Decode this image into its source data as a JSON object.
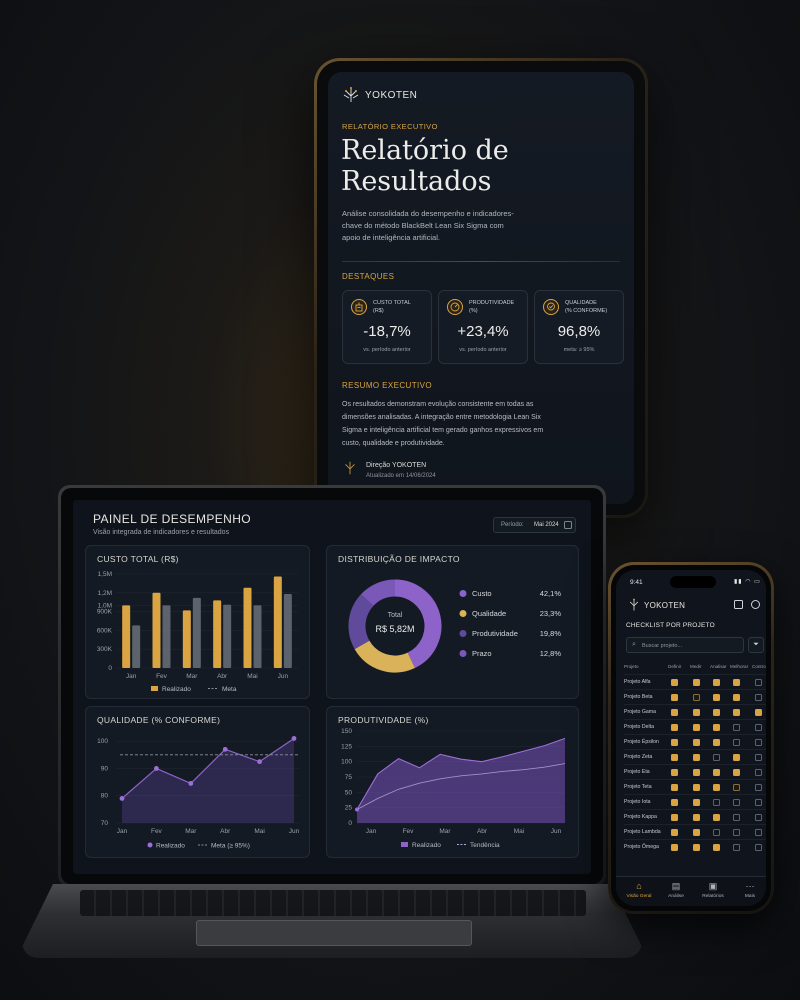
{
  "colors": {
    "gold": "#d9a441",
    "purple": "#8e63c9",
    "purple_light": "#b48be5",
    "bg": "#10151d",
    "slate": "#6f7680"
  },
  "tablet": {
    "brand": "YOKOTEN",
    "eyebrow": "RELATÓRIO EXECUTIVO",
    "title_line1": "Relatório de",
    "title_line2": "Resultados",
    "description_lines": [
      "Análise consolidada do desempenho e indicadores-",
      "chave do método BlackBelt Lean Six Sigma com",
      "apoio de inteligência artificial."
    ],
    "highlights_title": "DESTAQUES",
    "kpis": [
      {
        "icon": "cost-building-icon",
        "label_line1": "CUSTO TOTAL",
        "label_line2": "(R$)",
        "value": "-18,7%",
        "note": "vs. período anterior"
      },
      {
        "icon": "productivity-gauge-icon",
        "label_line1": "PRODUTIVIDADE",
        "label_line2": "(%)",
        "value": "+23,4%",
        "note": "vs. período anterior"
      },
      {
        "icon": "quality-badge-icon",
        "label_line1": "QUALIDADE",
        "label_line2": "(% CONFORME)",
        "value": "96,8%",
        "note": "meta: ≥ 95%"
      }
    ],
    "summary_title": "RESUMO EXECUTIVO",
    "summary_lines": [
      "Os resultados demonstram evolução consistente em todas as",
      "dimensões analisadas. A integração entre metodologia Lean Six",
      "Sigma e inteligência artificial tem gerado ganhos expressivos em",
      "custo, qualidade e produtividade."
    ],
    "signature_name": "Direção YOKOTEN",
    "signature_date": "Atualizado em 14/06/2024"
  },
  "laptop": {
    "title": "PAINEL DE DESEMPENHO",
    "subtitle": "Visão integrada de indicadores e resultados",
    "period_label": "Período:",
    "period_value": "Mai 2024",
    "cost_panel_title": "CUSTO TOTAL (R$)",
    "impact_panel_title": "DISTRIBUIÇÃO DE IMPACTO",
    "quality_panel_title": "QUALIDADE (% CONFORME)",
    "productivity_panel_title": "PRODUTIVIDADE (%)",
    "donut_center_label": "Total",
    "donut_center_value": "R$ 5,82M"
  },
  "chart_data": [
    {
      "type": "bar",
      "title": "CUSTO TOTAL (R$)",
      "categories": [
        "Jan",
        "Fev",
        "Mar",
        "Abr",
        "Mai",
        "Jun"
      ],
      "y_ticks": [
        "0",
        "300K",
        "600K",
        "900K",
        "1,0M",
        "1,2M",
        "1,5M"
      ],
      "ylim": [
        0,
        1500000
      ],
      "series": [
        {
          "name": "Realizado",
          "color": "#d9a441",
          "values": [
            1000000,
            1200000,
            920000,
            1080000,
            1280000,
            1460000
          ]
        },
        {
          "name": "Meta",
          "color": "#6f7680",
          "values": [
            680000,
            1000000,
            1120000,
            1010000,
            1000000,
            1180000
          ]
        }
      ]
    },
    {
      "type": "pie",
      "title": "DISTRIBUIÇÃO DE IMPACTO",
      "slices": [
        {
          "label": "Custo",
          "value": 42.1,
          "display": "42,1%",
          "color": "#8e63c9"
        },
        {
          "label": "Qualidade",
          "value": 23.3,
          "display": "23,3%",
          "color": "#d9b25a"
        },
        {
          "label": "Produtividade",
          "value": 19.8,
          "display": "19,8%",
          "color": "#5f4a9c"
        },
        {
          "label": "Prazo",
          "value": 12.8,
          "display": "12,8%",
          "color": "#7a58b8"
        }
      ]
    },
    {
      "type": "line",
      "title": "QUALIDADE (% CONFORME)",
      "categories": [
        "Jan",
        "Fev",
        "Mar",
        "Abr",
        "Mai",
        "Jun"
      ],
      "y_ticks": [
        70,
        80,
        90,
        100
      ],
      "ylim": [
        70,
        103
      ],
      "series": [
        {
          "name": "Realizado",
          "color": "#8e63c9",
          "values": [
            79,
            90,
            84.5,
            97,
            92.5,
            101
          ]
        },
        {
          "name": "Meta (≥ 95%)",
          "color": "#8a8f98",
          "values": [
            95,
            95,
            95,
            95,
            95,
            95
          ]
        }
      ]
    },
    {
      "type": "area",
      "title": "PRODUTIVIDADE (%)",
      "categories": [
        "Jan",
        "Fev",
        "Mar",
        "Abr",
        "Mai",
        "Jun"
      ],
      "y_ticks": [
        0,
        25,
        50,
        75,
        100,
        125,
        150
      ],
      "ylim": [
        0,
        150
      ],
      "x": [
        0,
        0.5,
        1,
        1.5,
        2,
        2.5,
        3,
        3.5,
        4,
        4.5,
        5
      ],
      "series": [
        {
          "name": "Realizado",
          "color": "#8e63c9",
          "values": [
            22,
            80,
            105,
            90,
            112,
            104,
            100,
            108,
            117,
            126,
            138
          ]
        },
        {
          "name": "Tendência",
          "color": "#b9a6d8",
          "values": [
            22,
            40,
            55,
            65,
            72,
            77,
            80,
            84,
            87,
            91,
            97
          ]
        }
      ]
    }
  ],
  "legends": {
    "cost": [
      "Realizado",
      "Meta"
    ],
    "quality": [
      "Realizado",
      "Meta (≥ 95%)"
    ],
    "productivity": [
      "Realizado",
      "Tendência"
    ]
  },
  "phone": {
    "time": "9:41",
    "brand": "YOKOTEN",
    "section_title": "CHECKLIST POR PROJETO",
    "search_placeholder": "Buscar projeto...",
    "columns": [
      "Projeto",
      "Definir",
      "Medir",
      "Analisar",
      "Melhorar",
      "Controlar"
    ],
    "rows": [
      {
        "name": "Projeto Alfa",
        "checks": [
          1,
          1,
          1,
          1,
          0
        ]
      },
      {
        "name": "Projeto Beta",
        "checks": [
          1,
          2,
          1,
          1,
          0
        ]
      },
      {
        "name": "Projeto Gama",
        "checks": [
          1,
          1,
          1,
          1,
          1
        ]
      },
      {
        "name": "Projeto Delta",
        "checks": [
          1,
          1,
          1,
          0,
          0
        ]
      },
      {
        "name": "Projeto Épsilon",
        "checks": [
          1,
          1,
          1,
          0,
          0
        ]
      },
      {
        "name": "Projeto Zeta",
        "checks": [
          1,
          1,
          0,
          1,
          0
        ]
      },
      {
        "name": "Projeto Eta",
        "checks": [
          1,
          1,
          1,
          1,
          0
        ]
      },
      {
        "name": "Projeto Teta",
        "checks": [
          1,
          1,
          1,
          2,
          0
        ]
      },
      {
        "name": "Projeto Iota",
        "checks": [
          1,
          1,
          0,
          0,
          0
        ]
      },
      {
        "name": "Projeto Kappa",
        "checks": [
          1,
          1,
          1,
          0,
          0
        ]
      },
      {
        "name": "Projeto Lambda",
        "checks": [
          1,
          1,
          0,
          0,
          0
        ]
      },
      {
        "name": "Projeto Ômega",
        "checks": [
          1,
          1,
          1,
          0,
          0
        ]
      }
    ],
    "nav": [
      {
        "icon": "home-icon",
        "label": "Visão Geral"
      },
      {
        "icon": "analysis-icon",
        "label": "Análise"
      },
      {
        "icon": "reports-icon",
        "label": "Relatórios"
      },
      {
        "icon": "more-icon",
        "label": "Mais"
      }
    ]
  }
}
